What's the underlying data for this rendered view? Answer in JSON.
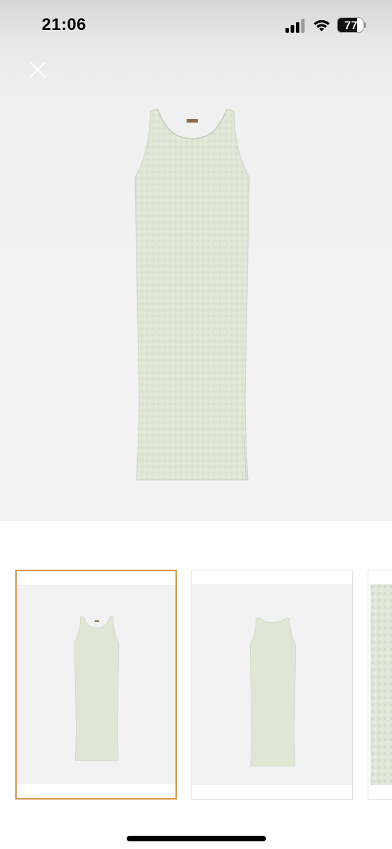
{
  "status_bar": {
    "time": "21:06",
    "battery_level": "77",
    "battery_fraction": 0.77,
    "icons": [
      "cellular-signal-icon",
      "wifi-icon",
      "battery-icon"
    ]
  },
  "viewer": {
    "close_icon": "close-icon",
    "main_image": "dress-front-image"
  },
  "thumbnails": {
    "selected_index": 0,
    "items": [
      {
        "image": "dress-front-thumbnail",
        "selected": true
      },
      {
        "image": "dress-back-thumbnail",
        "selected": false
      },
      {
        "image": "fabric-detail-thumbnail",
        "selected": false
      }
    ]
  },
  "colors": {
    "selected_border": "#d4924a",
    "dress_fill": "#dfe6d6",
    "background": "#f2f2f2"
  }
}
